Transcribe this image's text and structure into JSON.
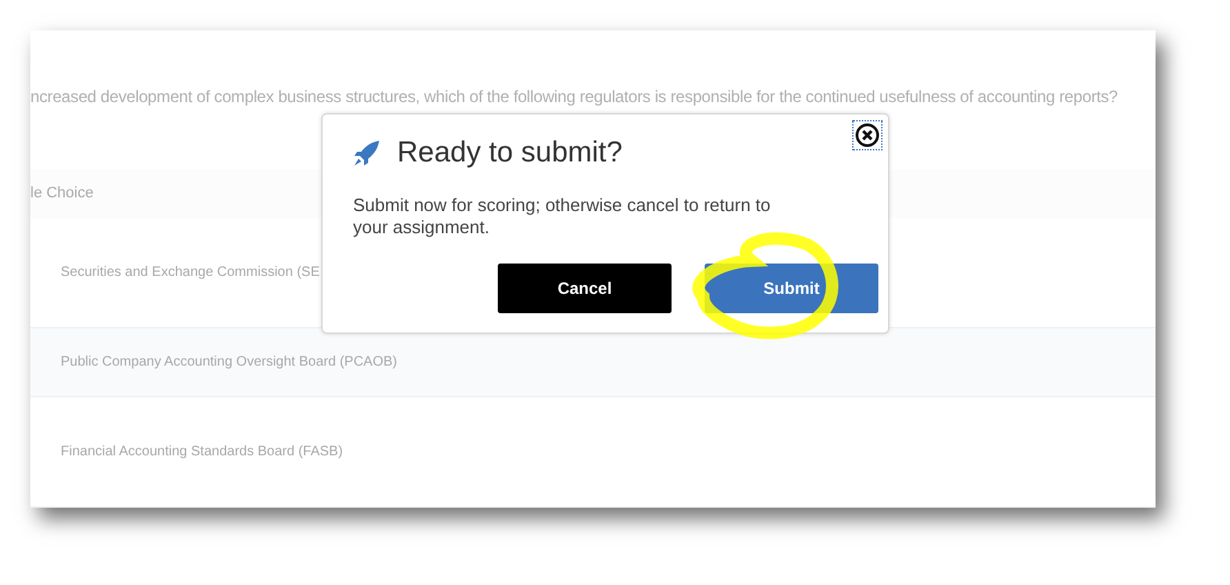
{
  "question": "ncreased development of complex business structures, which of the following regulators is responsible for the continued usefulness of accounting reports?",
  "choices_header": "le Choice",
  "choices": [
    {
      "label": "Securities and Exchange Commission (SE"
    },
    {
      "label": "Public Company Accounting Oversight Board (PCAOB)"
    },
    {
      "label": "Financial Accounting Standards Board (FASB)"
    }
  ],
  "dialog": {
    "title": "Ready to submit?",
    "message": "Submit now for scoring; otherwise cancel to return to your assignment.",
    "buttons": [
      {
        "label": "Cancel",
        "kind": "secondary"
      },
      {
        "label": "Submit",
        "kind": "primary",
        "highlighted": true
      }
    ]
  }
}
